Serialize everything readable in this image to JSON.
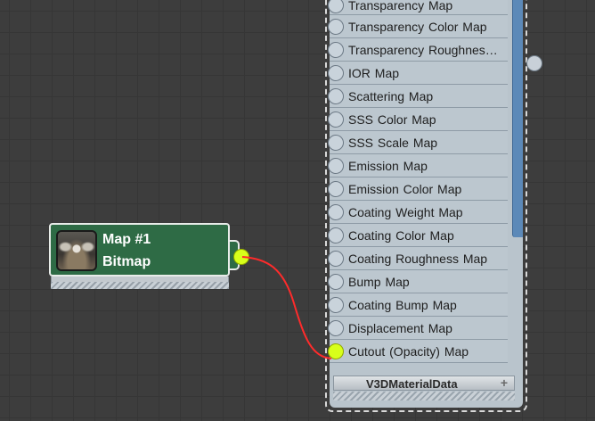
{
  "material_node": {
    "footer_label": "V3DMaterialData",
    "footer_plus": "+",
    "slots": [
      {
        "label": "Transparency Map",
        "connected": false
      },
      {
        "label": "Transparency Color Map",
        "connected": false
      },
      {
        "label": "Transparency  Roughnes…",
        "connected": false
      },
      {
        "label": "IOR Map",
        "connected": false
      },
      {
        "label": "Scattering Map",
        "connected": false
      },
      {
        "label": "SSS Color Map",
        "connected": false
      },
      {
        "label": "SSS Scale Map",
        "connected": false
      },
      {
        "label": "Emission Map",
        "connected": false
      },
      {
        "label": "Emission Color Map",
        "connected": false
      },
      {
        "label": "Coating Weight Map",
        "connected": false
      },
      {
        "label": "Coating Color Map",
        "connected": false
      },
      {
        "label": "Coating Roughness Map",
        "connected": false
      },
      {
        "label": "Bump Map",
        "connected": false
      },
      {
        "label": "Coating Bump Map",
        "connected": false
      },
      {
        "label": "Displacement Map",
        "connected": false
      },
      {
        "label": "Cutout (Opacity) Map",
        "connected": true
      }
    ]
  },
  "bitmap_node": {
    "title": "Map #1",
    "type": "Bitmap",
    "thumbnail_icon": "hdri-thumbnail"
  },
  "colors": {
    "node_green": "#2e6b45",
    "socket_active": "#d8ff1a",
    "wire": "#ff2b2b",
    "material_blue": "#5c89b8"
  }
}
